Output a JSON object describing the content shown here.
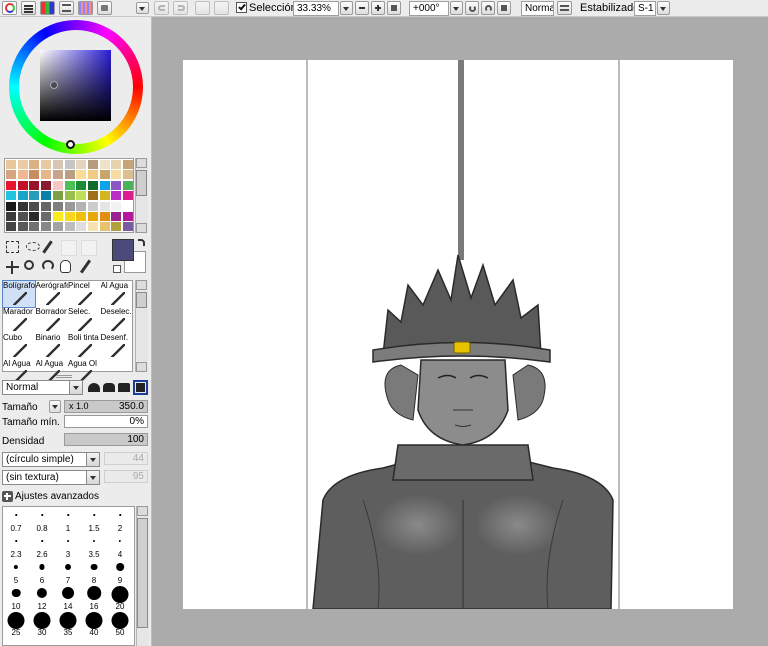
{
  "toolbar": {
    "selection_label": "Selección",
    "selection_checked": true,
    "zoom": "33.33%",
    "rotation": "+000°",
    "blend_mode": "Normal",
    "stabilizer_label": "Estabilizador",
    "stabilizer_value": "S-1"
  },
  "color": {
    "primary": "#4b4a7a",
    "secondary": "#ffffff",
    "palette": [
      [
        "#e9c79b",
        "#eccaa4",
        "#d9b184",
        "#e9c9a4",
        "#d7c6b6",
        "#c5c5c5",
        "#e2d4be",
        "#b59a7e",
        "#f0e1c9",
        "#e8d1ad",
        "#c7a37a"
      ],
      [
        "#d4a57e",
        "#f0b690",
        "#c98c5e",
        "#e7b78b",
        "#c7a58c",
        "#b89e82",
        "#f6dc98",
        "#f0cc83",
        "#c8a66b",
        "#f6dba3",
        "#dcbf8e"
      ],
      [
        "#e7162e",
        "#c40f28",
        "#9b1529",
        "#871d2f",
        "#f7c7c8",
        "#4ebf56",
        "#1c8b35",
        "#0f6c2a",
        "#0ba4e6",
        "#8b57c4",
        "#4cb15a"
      ],
      [
        "#21c4df",
        "#19a5c7",
        "#2a9bb8",
        "#0e7fa8",
        "#7d9e45",
        "#98bf4b",
        "#c0dd5b",
        "#9e6e1b",
        "#d3b51c",
        "#bb2cc4",
        "#da1e8d"
      ],
      [
        "#1a1a1a",
        "#333333",
        "#4c4c4c",
        "#666666",
        "#7f7f7f",
        "#999999",
        "#b3b3b3",
        "#cccccc",
        "#e5e5e5",
        "#f2f2f2",
        "#ffffff"
      ],
      [
        "#3a3a3a",
        "#505050",
        "#2a2a2a",
        "#6b6b6b",
        "#f7ec1d",
        "#f6d81a",
        "#f1c00f",
        "#e8a70f",
        "#e18e12",
        "#9a1f8f",
        "#b3179c"
      ],
      [
        "#444444",
        "#5a5a5a",
        "#707070",
        "#888888",
        "#a3a3a3",
        "#bdbdbd",
        "#dedede",
        "#f7e3b1",
        "#e9c26c",
        "#b4a03a",
        "#7a5aa0"
      ]
    ]
  },
  "tools": [
    {
      "label": "Bolígrafo",
      "icon": "pen-icon"
    },
    {
      "label": "Aerógrafo",
      "icon": "airbrush-icon"
    },
    {
      "label": "Pincel",
      "icon": "brush-icon"
    },
    {
      "label": "Al Agua",
      "icon": "water-brush-icon"
    },
    {
      "label": "Marador",
      "icon": "marker-icon"
    },
    {
      "label": "Borrador",
      "icon": "eraser-icon"
    },
    {
      "label": "Selec.",
      "icon": "select-brush-icon"
    },
    {
      "label": "Deselec.",
      "icon": "deselect-brush-icon"
    },
    {
      "label": "Cubo",
      "icon": "bucket-icon"
    },
    {
      "label": "Binario",
      "icon": "binary-pen-icon"
    },
    {
      "label": "Boli tinta",
      "icon": "ink-pen-icon"
    },
    {
      "label": "Desenf.",
      "icon": "blur-icon"
    },
    {
      "label": "Al Agua",
      "icon": "water-icon"
    },
    {
      "label": "Al Agua",
      "icon": "water-icon"
    },
    {
      "label": "Agua Ol",
      "icon": "oil-water-icon"
    },
    {
      "label": "",
      "icon": ""
    }
  ],
  "brush": {
    "blend": "Normal",
    "size_label": "Tamaño",
    "size_multiplier": "x 1.0",
    "size_value": "350.0",
    "min_size_label": "Tamaño mín.",
    "min_size_value": "0%",
    "density_label": "Densidad",
    "density_value": "100",
    "shape": "(círculo simple)",
    "shape_value": "44",
    "texture": "(sin textura)",
    "texture_value": "95",
    "advanced_label": "Ajustes avanzados"
  },
  "brush_sizes": [
    "0.7",
    "0.8",
    "1",
    "1.5",
    "2",
    "2.3",
    "2.6",
    "3",
    "3.5",
    "4",
    "5",
    "6",
    "7",
    "8",
    "9",
    "10",
    "12",
    "14",
    "16",
    "20",
    "25",
    "30",
    "35",
    "40",
    "50"
  ]
}
